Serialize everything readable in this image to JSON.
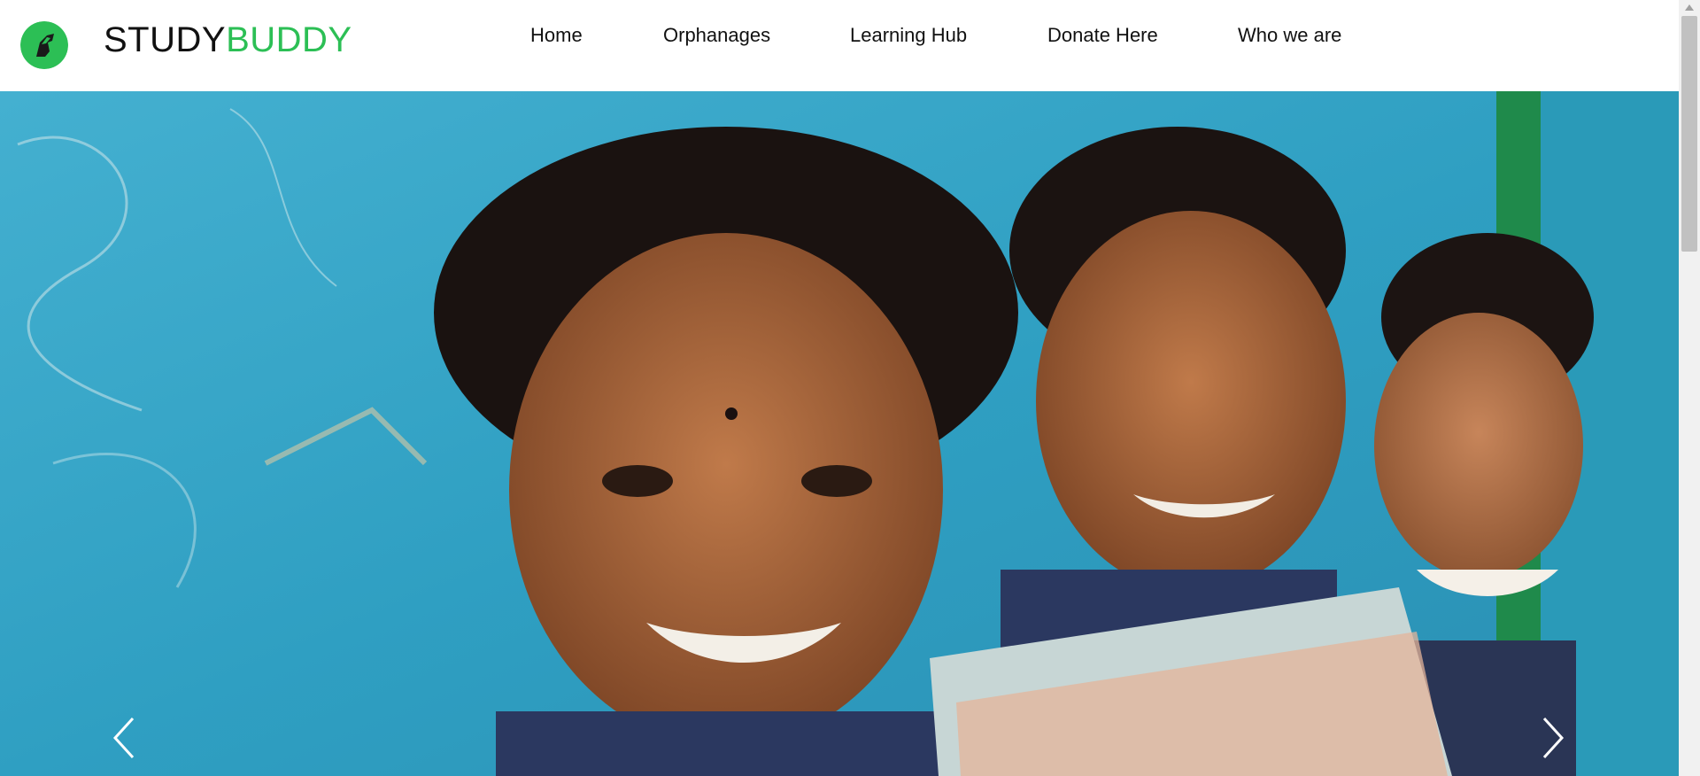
{
  "brand": {
    "part1": "STUDY",
    "part2": "BUDDY",
    "accent_color": "#2cbf55"
  },
  "nav": {
    "items": [
      {
        "label": "Home"
      },
      {
        "label": "Orphanages"
      },
      {
        "label": "Learning Hub"
      },
      {
        "label": "Donate Here"
      },
      {
        "label": "Who we are"
      }
    ]
  },
  "hero": {
    "image": "photo of three smiling children holding a book against a blue wall",
    "prev_icon": "chevron-left-icon",
    "next_icon": "chevron-right-icon"
  }
}
